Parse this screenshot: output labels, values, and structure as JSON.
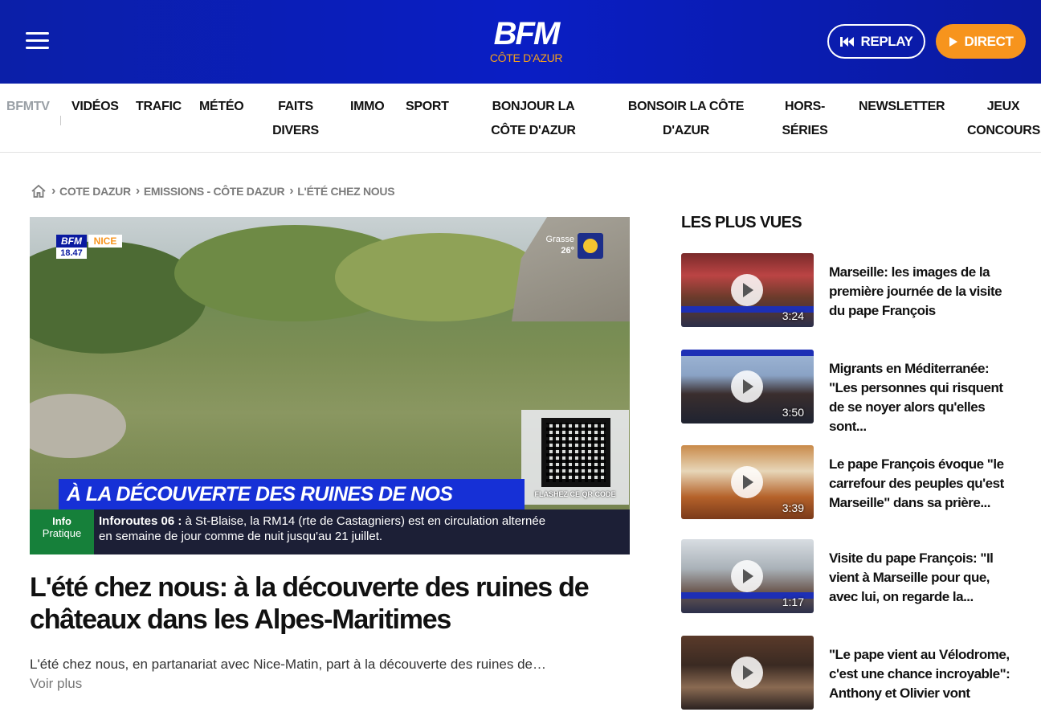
{
  "header": {
    "logo_main": "BFM",
    "logo_sub": "CÔTE D'AZUR",
    "replay_label": "REPLAY",
    "direct_label": "DIRECT",
    "colors": {
      "brand_blue": "#0a1ec4",
      "accent_orange": "#f7941d"
    }
  },
  "nav": {
    "items": [
      {
        "label": "BFMTV"
      },
      {
        "label": "VIDÉOS"
      },
      {
        "label": "TRAFIC"
      },
      {
        "label": "MÉTÉO"
      },
      {
        "label": "FAITS DIVERS"
      },
      {
        "label": "IMMO"
      },
      {
        "label": "SPORT"
      },
      {
        "label": "BONJOUR LA CÔTE D'AZUR"
      },
      {
        "label": "BONSOIR LA CÔTE D'AZUR"
      },
      {
        "label": "HORS-SÉRIES"
      },
      {
        "label": "NEWSLETTER"
      },
      {
        "label": "JEUX CONCOURS"
      }
    ]
  },
  "breadcrumb": {
    "items": [
      "COTE DAZUR",
      "EMISSIONS - CÔTE DAZUR",
      "L'ÉTÉ CHEZ NOUS"
    ]
  },
  "video": {
    "badge_brand": "BFM",
    "badge_channel": "NICE",
    "badge_time": "18.47",
    "weather_city": "Grasse",
    "weather_temp": "26°",
    "headline_overlay": "À LA DÉCOUVERTE DES RUINES DE NOS CHÂTEAUX",
    "qr_caption": "FLASHEZ CE QR CODE",
    "info_tag_line1": "Info",
    "info_tag_line2": "Pratique",
    "info_title": "Inforoutes 06 :",
    "info_text": " à St-Blaise, la RM14 (rte de Castagniers) est en circulation alternée en semaine de jour comme de nuit jusqu'au 21 juillet."
  },
  "article": {
    "title": "L'été chez nous: à la découverte des ruines de châteaux dans les Alpes-Maritimes",
    "description": "L'été chez nous, en partanariat avec Nice-Matin, part à la découverte des ruines de…",
    "read_more": "Voir plus"
  },
  "sidebar": {
    "title": "LES PLUS VUES",
    "items": [
      {
        "title": "Marseille: les images de la première journée de la visite du pape François",
        "duration": "3:24"
      },
      {
        "title": "Migrants en Méditerranée: \"Les personnes qui risquent de se noyer alors qu'elles sont...",
        "duration": "3:50"
      },
      {
        "title": "Le pape François évoque \"le carrefour des peuples qu'est Marseille\" dans sa prière...",
        "duration": "3:39"
      },
      {
        "title": "Visite du pape François: \"Il vient à Marseille pour que, avec lui, on regarde la...",
        "duration": "1:17"
      },
      {
        "title": "\"Le pape vient au Vélodrome, c'est une chance incroyable\": Anthony et Olivier vont",
        "duration": ""
      }
    ]
  }
}
